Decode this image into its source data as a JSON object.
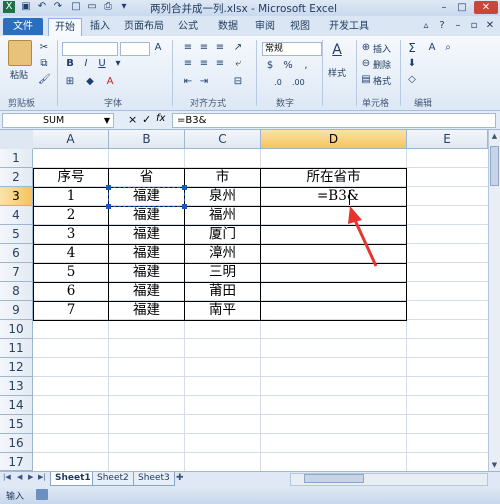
{
  "window": {
    "title": "两列合并成一列.xlsx - Microsoft Excel"
  },
  "tabs": [
    "文件",
    "开始",
    "插入",
    "页面布局",
    "公式",
    "数据",
    "审阅",
    "视图",
    "开发工具"
  ],
  "ribbon": {
    "clipboard": {
      "paste": "粘贴",
      "label": "剪贴板"
    },
    "font": {
      "bold": "B",
      "italic": "I",
      "underline": "U",
      "label": "字体"
    },
    "alignment": {
      "label": "对齐方式"
    },
    "number": {
      "format": "常规",
      "percent": "%",
      "comma": ",",
      "currency": "$",
      "label": "数字"
    },
    "styles": {
      "label": "样式",
      "big_icon": "A"
    },
    "cells": {
      "insert": "插入",
      "delete": "删除",
      "format": "格式",
      "label": "单元格"
    },
    "editing": {
      "sigma": "Σ",
      "sort": "A",
      "label": "编辑"
    }
  },
  "formula_bar": {
    "name_box": "SUM",
    "cancel": "×",
    "enter": "✓",
    "fx": "fx",
    "formula": "=B3&"
  },
  "columns": [
    "A",
    "B",
    "C",
    "D",
    "E"
  ],
  "rows": [
    "1",
    "2",
    "3",
    "4",
    "5",
    "6",
    "7",
    "8",
    "9",
    "10",
    "11",
    "12",
    "13",
    "14",
    "15",
    "16",
    "17"
  ],
  "table": {
    "headers": [
      "序号",
      "省",
      "市",
      "所在省市"
    ],
    "rows": [
      [
        "1",
        "福建",
        "泉州",
        "=B3&"
      ],
      [
        "2",
        "福建",
        "福州",
        ""
      ],
      [
        "3",
        "福建",
        "厦门",
        ""
      ],
      [
        "4",
        "福建",
        "漳州",
        ""
      ],
      [
        "5",
        "福建",
        "三明",
        ""
      ],
      [
        "6",
        "福建",
        "莆田",
        ""
      ],
      [
        "7",
        "福建",
        "南平",
        ""
      ]
    ]
  },
  "sheets": [
    "Sheet1",
    "Sheet2",
    "Sheet3"
  ],
  "status": {
    "mode": "输入"
  },
  "colors": {
    "accent": "#2a6fbf",
    "arrow": "#e8342f",
    "selection": "#1a56c8"
  }
}
